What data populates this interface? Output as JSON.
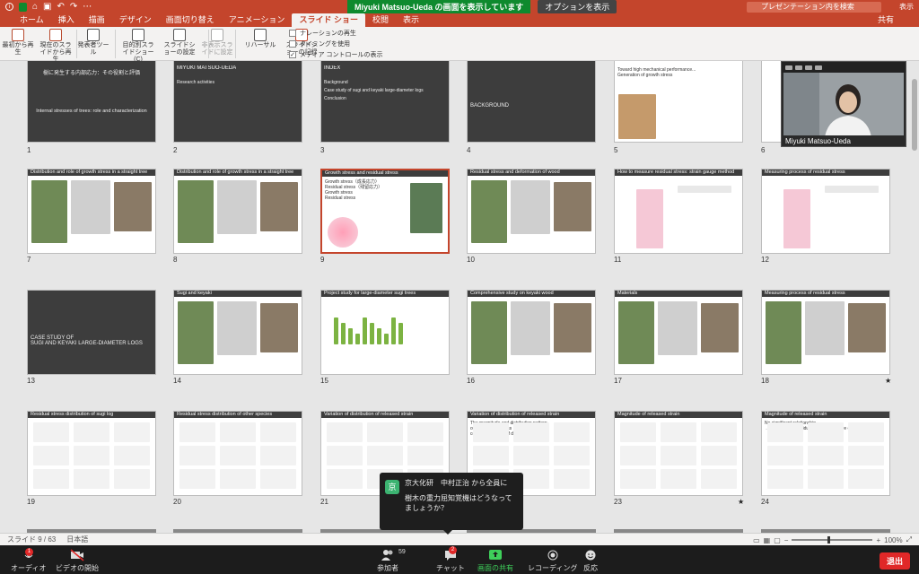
{
  "titlebar": {
    "share_message": "Miyuki Matsuo-Ueda の画面を表示しています",
    "view_options": "オプションを表示",
    "search_placeholder": "プレゼンテーション内を検索",
    "view_label": "表示"
  },
  "tabs": [
    "ホーム",
    "挿入",
    "描画",
    "デザイン",
    "画面切り替え",
    "アニメーション",
    "スライド ショー",
    "校閲",
    "表示"
  ],
  "share_tab": "共有",
  "ribbon": {
    "buttons": [
      {
        "label": "最初から再生",
        "icon": "play-from-start-icon"
      },
      {
        "label": "現在のスライドから再生",
        "icon": "play-from-current-icon"
      },
      {
        "label": "発表者ツール",
        "icon": "presenter-view-icon"
      },
      {
        "label": "目的別スライドショー(C)",
        "icon": "custom-show-icon"
      },
      {
        "label": "スライドショーの設定",
        "icon": "setup-show-icon"
      },
      {
        "label": "非表示スライドに設定",
        "icon": "hide-slide-icon"
      },
      {
        "label": "リハーサル",
        "icon": "rehearse-icon"
      },
      {
        "label": "スライドショーの記録",
        "icon": "record-show-icon"
      }
    ],
    "checkboxes": [
      {
        "label": "ナレーションの再生",
        "checked": false
      },
      {
        "label": "タイミングを使用",
        "checked": false
      },
      {
        "label": "メディア コントロールの表示",
        "checked": true
      }
    ]
  },
  "slides": [
    {
      "n": "1",
      "title": "",
      "kind": "title-dark",
      "text": [
        "樹に発生する内部応力：その役割と評価",
        "Internal stresses of trees: role and characterization"
      ]
    },
    {
      "n": "2",
      "title": "MIYUKI MATSUO-UEDA",
      "kind": "profile",
      "text": [
        "Research activities"
      ]
    },
    {
      "n": "3",
      "title": "INDEX",
      "kind": "index",
      "text": [
        "Background",
        "Case study of sugi and keyaki large-diameter logs",
        "Conclusion"
      ]
    },
    {
      "n": "4",
      "title": "",
      "kind": "section",
      "text": [
        "BACKGROUND"
      ]
    },
    {
      "n": "5",
      "title": "",
      "kind": "text",
      "text": [
        "Toward high mechanical performance...",
        "Generation of growth stress"
      ]
    },
    {
      "n": "6",
      "title": "",
      "kind": "blank",
      "text": []
    },
    {
      "n": "7",
      "title": "Distribution and role of growth stress in a straight tree",
      "kind": "photo",
      "text": []
    },
    {
      "n": "8",
      "title": "Distribution and role of growth stress in a straight tree",
      "kind": "photo",
      "text": []
    },
    {
      "n": "9",
      "title": "Growth stress and residual stress",
      "kind": "stress",
      "text": [
        "Growth stress（成長応力）",
        "Residual stress（残留応力）",
        "Growth stress",
        "Residual stress"
      ]
    },
    {
      "n": "10",
      "title": "Residual stress and deformation of wood",
      "kind": "photo",
      "text": []
    },
    {
      "n": "11",
      "title": "How to measure residual stress: strain gauge method",
      "kind": "diagram",
      "text": []
    },
    {
      "n": "12",
      "title": "Measuring process of residual stress",
      "kind": "diagram",
      "text": []
    },
    {
      "n": "13",
      "title": "",
      "kind": "section",
      "text": [
        "CASE STUDY OF",
        "SUGI AND KEYAKI LARGE-DIAMETER LOGS"
      ]
    },
    {
      "n": "14",
      "title": "Sugi and keyaki",
      "kind": "trees",
      "text": []
    },
    {
      "n": "15",
      "title": "Project study for large-diameter sugi trees",
      "kind": "bars",
      "text": []
    },
    {
      "n": "16",
      "title": "Comprehensive study on keyaki wood",
      "kind": "photo",
      "text": []
    },
    {
      "n": "17",
      "title": "Materials",
      "kind": "photo",
      "text": []
    },
    {
      "n": "18",
      "title": "Measuring process of residual stress",
      "kind": "photo",
      "text": []
    },
    {
      "n": "19",
      "title": "Residual stress distribution of sugi log",
      "kind": "plot",
      "text": []
    },
    {
      "n": "20",
      "title": "Residual stress distribution of other species",
      "kind": "plot",
      "text": []
    },
    {
      "n": "21",
      "title": "Variation of distribution of released strain",
      "kind": "grid",
      "text": []
    },
    {
      "n": "22",
      "title": "Variation of distribution of released strain",
      "kind": "grid",
      "text": [
        "The magnitude and distribution pattern",
        "of the residual stress",
        "control the extent of distortion."
      ]
    },
    {
      "n": "23",
      "title": "Magnitude of released strain",
      "kind": "plot",
      "text": []
    },
    {
      "n": "24",
      "title": "Magnitude of released strain",
      "kind": "scatter",
      "text": [
        "No significant relationship",
        "→ Prediction of residual stress is a future challenge."
      ]
    }
  ],
  "stars": [
    "18",
    "23"
  ],
  "status": {
    "slide": "スライド 9 / 63",
    "lang": "日本語",
    "zoom": "100%"
  },
  "video": {
    "name": "Miyuki Matsuo-Ueda"
  },
  "zoom_bar": {
    "audio": "オーディオ",
    "video": "ビデオの開始",
    "participants": "参加者",
    "participants_count": "59",
    "chat": "チャット",
    "chat_badge": "2",
    "share": "画面の共有",
    "record": "レコーディング",
    "reactions": "反応",
    "end": "退出",
    "audio_badge": "1"
  },
  "chat_popup": {
    "sender": "京大化研　中村正治 から全員に",
    "avatar": "京",
    "message": "樹木の重力屈知覚機はどうなってましょうか？"
  },
  "colors": {
    "ppt_red": "#c4452c",
    "zoom_green": "#0e8a2e",
    "end_red": "#e02828"
  }
}
